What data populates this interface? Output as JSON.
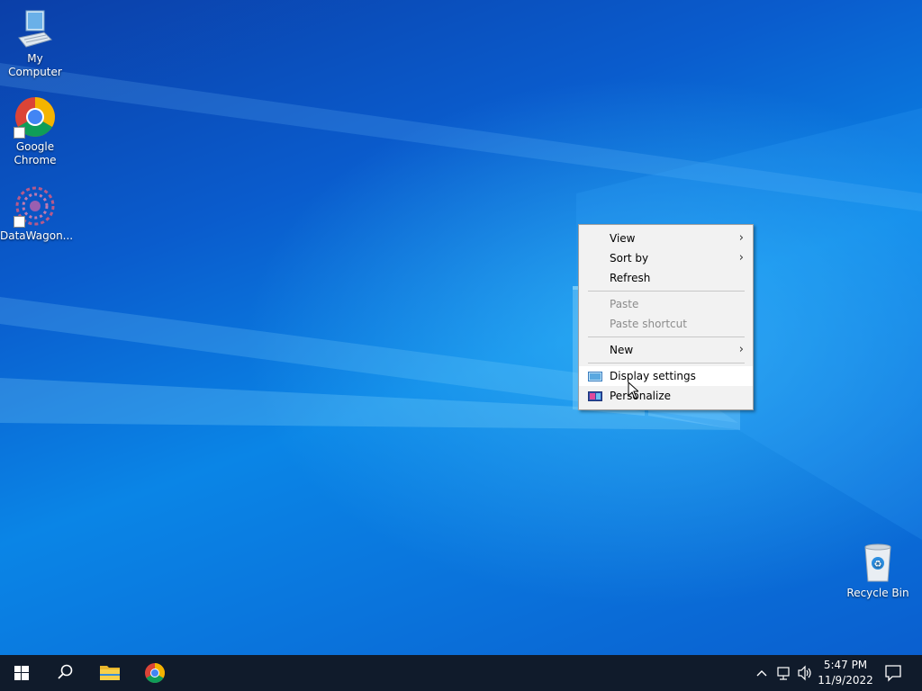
{
  "desktop": {
    "icons": [
      {
        "label": "My Computer",
        "icon": "computer-icon"
      },
      {
        "label": "Google Chrome",
        "icon": "chrome-icon"
      },
      {
        "label": "DataWagon...",
        "icon": "datawagon-icon"
      },
      {
        "label": "Recycle Bin",
        "icon": "recycle-bin-icon"
      }
    ]
  },
  "context_menu": {
    "items": [
      {
        "label": "View",
        "submenu": true,
        "enabled": true
      },
      {
        "label": "Sort by",
        "submenu": true,
        "enabled": true
      },
      {
        "label": "Refresh",
        "submenu": false,
        "enabled": true
      },
      {
        "label": "Paste",
        "submenu": false,
        "enabled": false
      },
      {
        "label": "Paste shortcut",
        "submenu": false,
        "enabled": false
      },
      {
        "label": "New",
        "submenu": true,
        "enabled": true
      },
      {
        "label": "Display settings",
        "submenu": false,
        "enabled": true,
        "hovered": true,
        "icon": "display-settings-icon"
      },
      {
        "label": "Personalize",
        "submenu": false,
        "enabled": true,
        "icon": "personalize-icon"
      }
    ]
  },
  "taskbar": {
    "start_icon": "windows-start-icon",
    "search_icon": "search-icon",
    "pinned": [
      "file-explorer-icon",
      "chrome-icon"
    ],
    "tray": {
      "icons": [
        "chevron-up-icon",
        "network-icon",
        "volume-icon",
        "notifications-icon"
      ],
      "time": "5:47 PM",
      "date": "11/9/2022"
    }
  },
  "colors": {
    "taskbar": "#101b2b",
    "menu_bg": "#f2f2f2",
    "wallpaper_accent": "#0a74dc"
  }
}
